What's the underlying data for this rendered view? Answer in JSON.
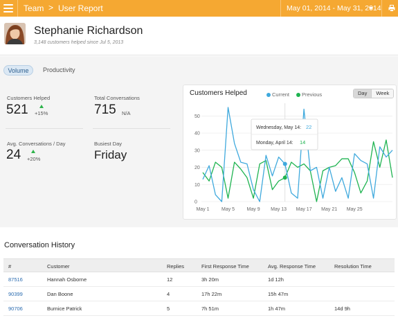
{
  "topbar": {
    "section": "Team",
    "separator": ">",
    "page": "User Report",
    "date_range": "May 01, 2014 - May 31, 2014",
    "bg_color": "#f5a832",
    "menu_icon": "hamburger-icon",
    "print_icon": "printer-icon"
  },
  "profile": {
    "name": "Stephanie Richardson",
    "subtitle": "3,148 customers helped since Jul 5, 2013"
  },
  "tabs": {
    "volume": "Volume",
    "productivity": "Productivity",
    "active": "Volume"
  },
  "stats": {
    "customers_helped": {
      "label": "Customers Helped",
      "value": "521",
      "delta": "+15%"
    },
    "total_conversations": {
      "label": "Total Conversations",
      "value": "715",
      "delta": "N/A"
    },
    "avg_conversations": {
      "label": "Avg. Conversations / Day",
      "value": "24",
      "delta": "+20%"
    },
    "busiest_day": {
      "label": "Busiest Day",
      "value": "Friday"
    }
  },
  "chart": {
    "title": "Customers Helped",
    "legend_current": "Current",
    "legend_previous": "Previous",
    "btn_day": "Day",
    "btn_week": "Week",
    "colors": {
      "current": "#3fa9dd",
      "previous": "#1eb350"
    },
    "tooltip": {
      "current_label": "Wednesday, May 14:",
      "current_value": "22",
      "previous_label": "Monday, April 14:",
      "previous_value": "14"
    }
  },
  "chart_data": {
    "type": "line",
    "title": "Customers Helped",
    "x": [
      "May 1",
      "May 2",
      "May 3",
      "May 4",
      "May 5",
      "May 6",
      "May 7",
      "May 8",
      "May 9",
      "May 10",
      "May 11",
      "May 12",
      "May 13",
      "May 14",
      "May 15",
      "May 16",
      "May 17",
      "May 18",
      "May 19",
      "May 20",
      "May 21",
      "May 22",
      "May 23",
      "May 24",
      "May 25",
      "May 26",
      "May 27",
      "May 28",
      "May 29",
      "May 30",
      "May 31"
    ],
    "xticks": [
      "May 1",
      "May 5",
      "May 9",
      "May 13",
      "May 17",
      "May 21",
      "May 25"
    ],
    "yticks": [
      0,
      10,
      20,
      30,
      40,
      50
    ],
    "ylim": [
      0,
      55
    ],
    "series": [
      {
        "name": "Current",
        "values": [
          13,
          21,
          4,
          0,
          55,
          34,
          23,
          22,
          7,
          0,
          27,
          15,
          26,
          22,
          5,
          2,
          54,
          18,
          20,
          2,
          20,
          6,
          14,
          2,
          28,
          24,
          22,
          2,
          32,
          26,
          30
        ]
      },
      {
        "name": "Previous",
        "values": [
          17,
          12,
          23,
          20,
          2,
          23,
          19,
          14,
          2,
          22,
          24,
          7,
          12,
          14,
          23,
          20,
          22,
          18,
          0,
          18,
          20,
          21,
          25,
          25,
          17,
          5,
          12,
          35,
          20,
          36,
          14
        ]
      }
    ],
    "highlight_index": 13,
    "grid": true,
    "legend": "top"
  },
  "history": {
    "title": "Conversation History",
    "columns": [
      "#",
      "Customer",
      "Replies",
      "First Response Time",
      "Avg. Response Time",
      "Resolution Time"
    ],
    "rows": [
      [
        "87516",
        "Hannah Osborne",
        "12",
        "3h 20m",
        "1d 12h",
        ""
      ],
      [
        "90399",
        "Dan Boone",
        "4",
        "17h 22m",
        "15h 47m",
        ""
      ],
      [
        "90706",
        "Burnice Patrick",
        "5",
        "7h 51m",
        "1h 47m",
        "14d 9h"
      ]
    ]
  }
}
